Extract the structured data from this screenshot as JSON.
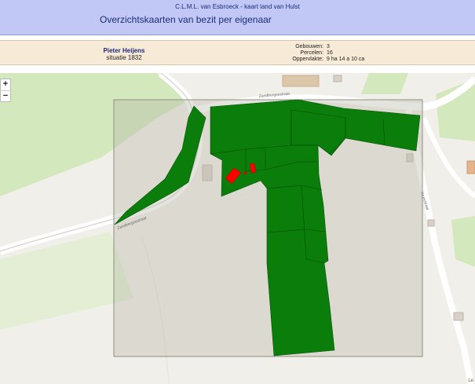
{
  "header": {
    "subtitle": "C.L.M.L. van Esbroeck - kaart land van Hulst",
    "title": "Overzichtskaarten van bezit per eigenaar"
  },
  "owner": {
    "name": "Pieter Heijens",
    "period": "situatie 1832"
  },
  "stats": [
    {
      "label": "Gebouwen:",
      "value": "3"
    },
    {
      "label": "Percelen:",
      "value": "16"
    },
    {
      "label": "Oppervlakte:",
      "value": "9 ha 14 a 10 ca"
    }
  ],
  "zoom": {
    "in_label": "+",
    "out_label": "−"
  },
  "map": {
    "attribution": "Le",
    "street_labels": [
      "Zandbergsestraat",
      "Zandbergsestraat",
      "Kruisstraat"
    ],
    "colors": {
      "parcel": "#0b7d0b",
      "building": "#ff0000",
      "overlay": "#b3b3a3"
    }
  }
}
